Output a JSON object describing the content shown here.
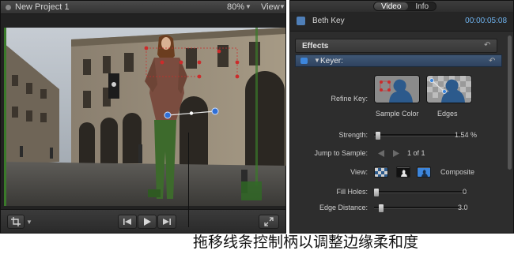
{
  "viewer": {
    "project_title": "New Project 1",
    "zoom_level": "80%",
    "view_menu": "View",
    "icons": {
      "crop": "crop-icon",
      "previous": "previous-frame-icon",
      "play": "play-icon",
      "next": "next-frame-icon",
      "fullscreen": "fullscreen-icon"
    },
    "storefront_sign": "Apple-logo"
  },
  "inspector": {
    "tabs": [
      {
        "label": "Video",
        "active": true
      },
      {
        "label": "Info",
        "active": false
      }
    ],
    "clip_name": "Beth Key",
    "duration": "00:00:05:08",
    "effects_label": "Effects",
    "keyer_label": "Keyer:",
    "refine_key": {
      "label": "Refine Key:",
      "sample_color_label": "Sample Color",
      "edges_label": "Edges"
    },
    "strength": {
      "label": "Strength:",
      "value": "1.54",
      "unit": "%",
      "level": 0.02
    },
    "jump_to_sample": {
      "label": "Jump to Sample:",
      "value": "1 of 1"
    },
    "view": {
      "label": "View:",
      "mode": "Composite"
    },
    "fill_holes": {
      "label": "Fill Holes:",
      "value": "0",
      "level": 0.0
    },
    "edge_distance": {
      "label": "Edge Distance:",
      "value": "3.0",
      "level": 0.05
    }
  },
  "callout": {
    "text": "拖移线条控制柄以调整边缘柔和度"
  },
  "colors": {
    "accent": "#3d86dc",
    "timecode": "#6fb3ee",
    "onscreen_handles": "#2f6fd6",
    "sample_points": "#cc2b2b",
    "green_spill": "#3a7a2a"
  }
}
